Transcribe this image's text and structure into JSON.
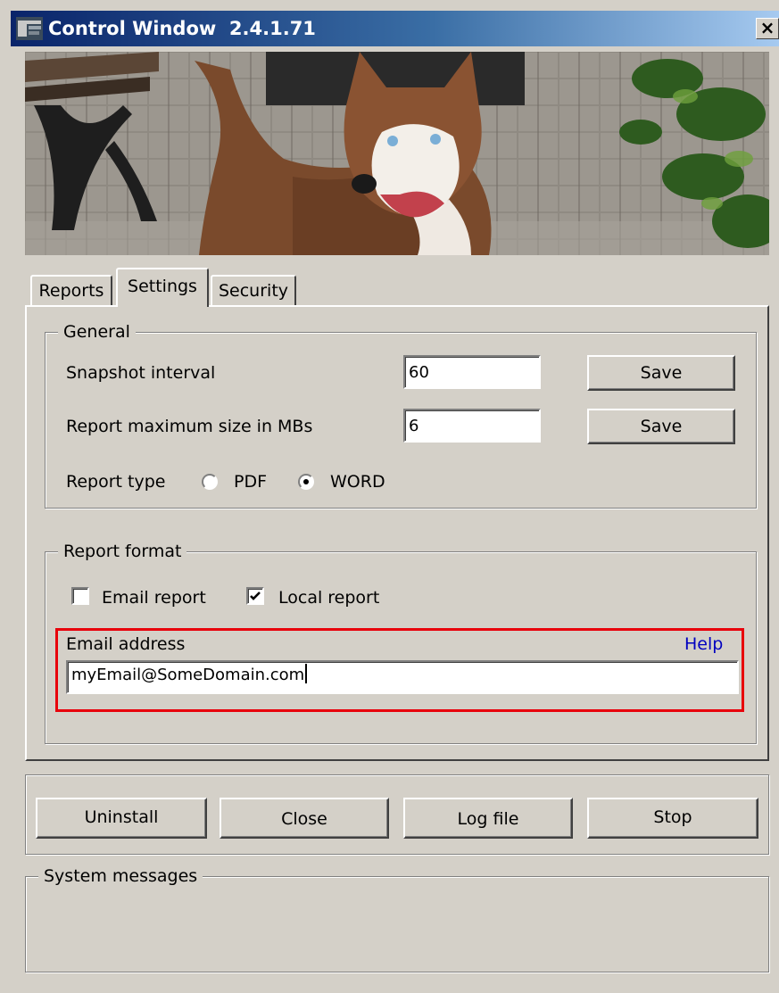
{
  "window": {
    "title": "Control Window",
    "version": "2.4.1.71",
    "close_label": "×"
  },
  "tabs": [
    {
      "label": "Reports",
      "active": false
    },
    {
      "label": "Settings",
      "active": true
    },
    {
      "label": "Security",
      "active": false
    }
  ],
  "general": {
    "legend": "General",
    "snapshot_label": "Snapshot interval",
    "snapshot_value": "60",
    "snapshot_save": "Save",
    "maxsize_label": "Report maximum size in MBs",
    "maxsize_value": "6",
    "maxsize_save": "Save",
    "report_type_label": "Report type",
    "options": [
      {
        "label": "PDF",
        "selected": false
      },
      {
        "label": "WORD",
        "selected": true
      }
    ]
  },
  "report_format": {
    "legend": "Report format",
    "email_report": {
      "label": "Email report",
      "checked": false
    },
    "local_report": {
      "label": "Local report",
      "checked": true
    },
    "email_address_label": "Email address",
    "help_label": "Help",
    "email_value": "myEmail@SomeDomain.com"
  },
  "actions": {
    "uninstall": "Uninstall",
    "close": "Close",
    "log_file": "Log file",
    "stop": "Stop"
  },
  "system_messages": {
    "legend": "System messages"
  },
  "colors": {
    "highlight": "#e8000b",
    "link": "#0000c0",
    "face": "#d4d0c8"
  }
}
